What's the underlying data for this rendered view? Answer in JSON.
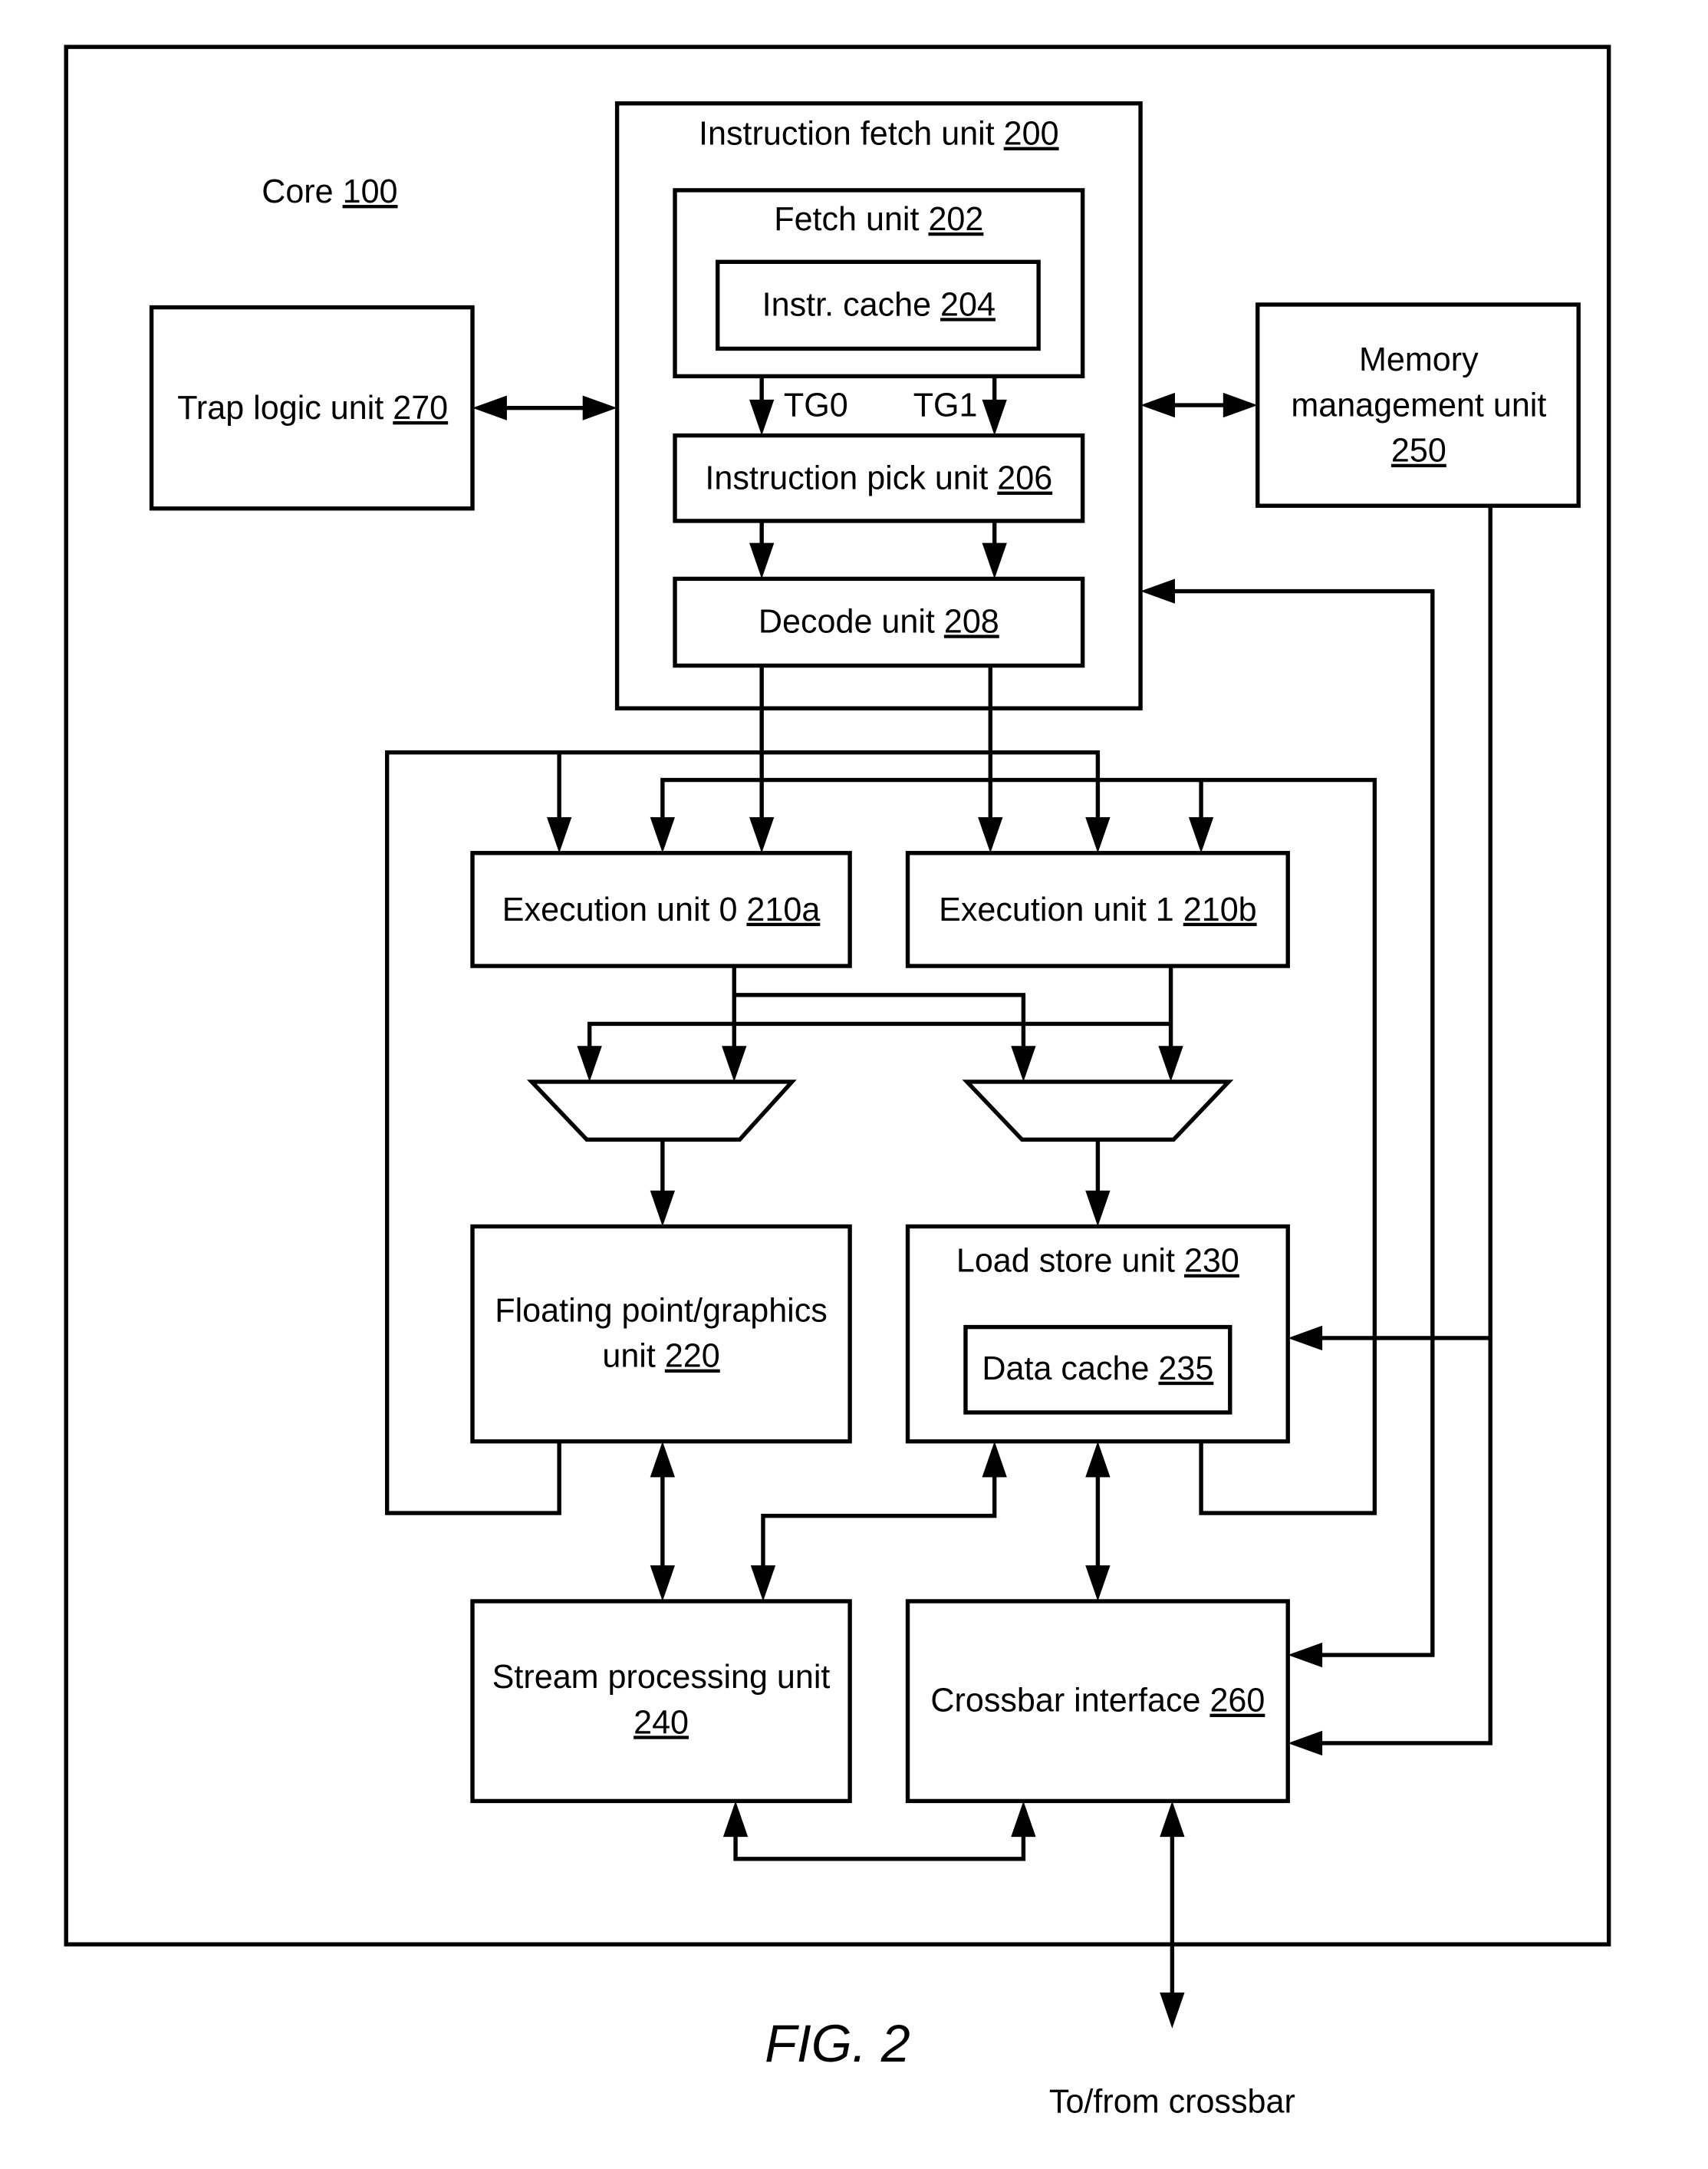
{
  "figure_label": "FIG. 2",
  "external_label": "To/from crossbar",
  "core": {
    "name": "Core",
    "ref": "100"
  },
  "blocks": {
    "ifu": {
      "name": "Instruction fetch unit",
      "ref": "200"
    },
    "fetch": {
      "name": "Fetch unit",
      "ref": "202"
    },
    "icache": {
      "name": "Instr. cache",
      "ref": "204"
    },
    "pick": {
      "name": "Instruction pick unit",
      "ref": "206"
    },
    "decode": {
      "name": "Decode unit",
      "ref": "208"
    },
    "trap": {
      "name": "Trap logic unit",
      "ref": "270"
    },
    "mmu": {
      "name_line1": "Memory",
      "name_line2": "management unit",
      "ref": "250"
    },
    "exu0": {
      "name": "Execution unit 0",
      "ref": "210a"
    },
    "exu1": {
      "name": "Execution unit 1",
      "ref": "210b"
    },
    "fgu": {
      "name_line1": "Floating point/graphics",
      "name_line2": "unit",
      "ref": "220"
    },
    "lsu": {
      "name": "Load store unit",
      "ref": "230"
    },
    "dcache": {
      "name": "Data cache",
      "ref": "235"
    },
    "spu": {
      "name_line1": "Stream processing unit",
      "ref": "240"
    },
    "xbar": {
      "name": "Crossbar interface",
      "ref": "260"
    }
  },
  "thread_groups": [
    "TG0",
    "TG1"
  ]
}
